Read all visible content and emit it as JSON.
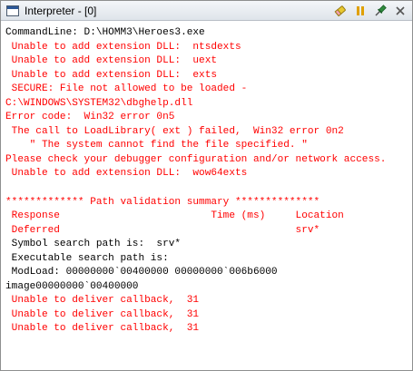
{
  "window": {
    "title": "Interpreter - [0]"
  },
  "toolbar": {
    "icons": [
      "eraser-icon",
      "pause-icon",
      "pin-icon",
      "close-icon"
    ],
    "colors": {
      "eraser": "#e8c830",
      "pause": "#e0a000",
      "pin": "#2e8b3d",
      "close": "#555555"
    }
  },
  "output": {
    "colors": {
      "error": "#ff0000",
      "normal": "#000000"
    },
    "lines": [
      {
        "text": "CommandLine: D:\\HOMM3\\Heroes3.exe",
        "color": "black"
      },
      {
        "text": " Unable to add extension DLL:  ntsdexts",
        "color": "red"
      },
      {
        "text": " Unable to add extension DLL:  uext",
        "color": "red"
      },
      {
        "text": " Unable to add extension DLL:  exts",
        "color": "red"
      },
      {
        "text": " SECURE: File not allowed to be loaded -",
        "color": "red"
      },
      {
        "text": "C:\\WINDOWS\\SYSTEM32\\dbghelp.dll",
        "color": "red"
      },
      {
        "text": "Error code:  Win32 error 0n5",
        "color": "red"
      },
      {
        "text": " The call to LoadLibrary( ext ) failed,  Win32 error 0n2",
        "color": "red"
      },
      {
        "text": "    \" The system cannot find the file specified. \"",
        "color": "red"
      },
      {
        "text": "Please check your debugger configuration and/or network access.",
        "color": "red"
      },
      {
        "text": " Unable to add extension DLL:  wow64exts",
        "color": "red"
      },
      {
        "text": "",
        "color": "black"
      },
      {
        "text": "************* Path validation summary **************",
        "color": "red"
      },
      {
        "text": " Response                         Time (ms)     Location",
        "color": "red"
      },
      {
        "text": " Deferred                                       srv*",
        "color": "red"
      },
      {
        "text": " Symbol search path is:  srv*",
        "color": "black"
      },
      {
        "text": " Executable search path is:",
        "color": "black"
      },
      {
        "text": " ModLoad: 00000000`00400000 00000000`006b6000",
        "color": "black"
      },
      {
        "text": "image00000000`00400000",
        "color": "black"
      },
      {
        "text": " Unable to deliver callback,  31",
        "color": "red"
      },
      {
        "text": " Unable to deliver callback,  31",
        "color": "red"
      },
      {
        "text": " Unable to deliver callback,  31",
        "color": "red"
      }
    ]
  }
}
